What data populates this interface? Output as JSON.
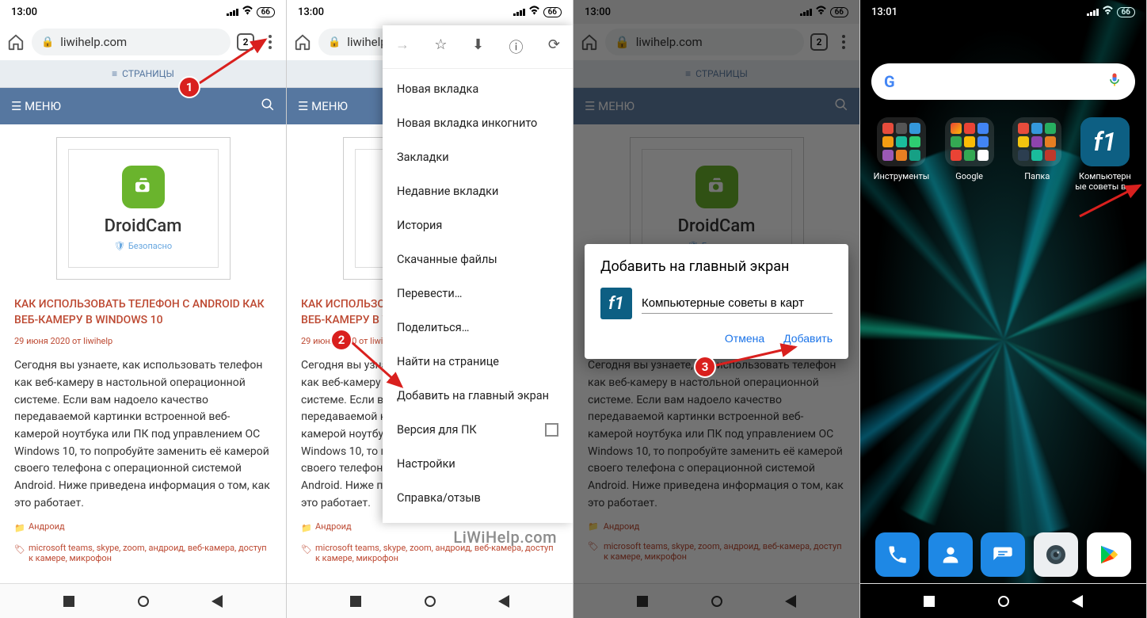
{
  "status": {
    "time1": "13:00",
    "time4": "13:01",
    "battery": "66"
  },
  "addr": {
    "url": "liwihelp.com",
    "tabs": "2"
  },
  "site": {
    "pages": "СТРАНИЦЫ",
    "menu": "МЕНЮ",
    "droidcam": "DroidCam",
    "safe": "Безопасно",
    "title": "КАК ИСПОЛЬЗОВАТЬ ТЕЛЕФОН С ANDROID КАК ВЕБ-КАМЕРУ В WINDOWS 10",
    "title_short": "КАК ИСПОЛЬЗО\nВЕБ-КАМЕРУ В",
    "meta": "29 июня 2020 от liwihelp",
    "meta_short": "29 июня 2020 от liwi",
    "body": "Сегодня вы узнаете, как использовать телефон как веб-камеру в настольной операционной системе. Если вам надоело качество передаваемой картинки встроенной веб-камерой ноутбука или ПК под управлением ОС Windows 10, то попробуйте заменить её камерой своего телефона с операционной системой Android. Ниже приведена информация о том, как это работает.",
    "body3": "Сегодня вы узнаете, как использовать телефон как веб-камеру в настольной операционной системе. Если вам надоело качество передаваемой картинки встроенной веб-камерой ноутбука или ПК под управлением ОС Windows 10, то попробуйте заменить её камерой своего телефона с операционной системой Android. Ниже приведена информация о том, как это работает.",
    "cat": "Андроид",
    "tags": "microsoft teams, skype, zoom, андроид, веб-камера, доступ к камере, микрофон"
  },
  "menu": {
    "items": [
      "Новая вкладка",
      "Новая вкладка инкогнито",
      "Закладки",
      "Недавние вкладки",
      "История",
      "Скачанные файлы",
      "Перевести…",
      "Поделиться…",
      "Найти на странице",
      "Добавить на главный экран",
      "Версия для ПК",
      "Настройки",
      "Справка/отзыв"
    ]
  },
  "dialog": {
    "title": "Добавить на главный экран",
    "input": "Компьютерные советы в карт",
    "cancel": "Отмена",
    "add": "Добавить"
  },
  "home": {
    "folders": [
      "Инструменты",
      "Google",
      "Папка",
      "Компьютерные советы в ..."
    ],
    "f1_short": "Компьютерн\nые советы в ...",
    "f1": "f1"
  },
  "watermark": "LiWiHelp.com"
}
